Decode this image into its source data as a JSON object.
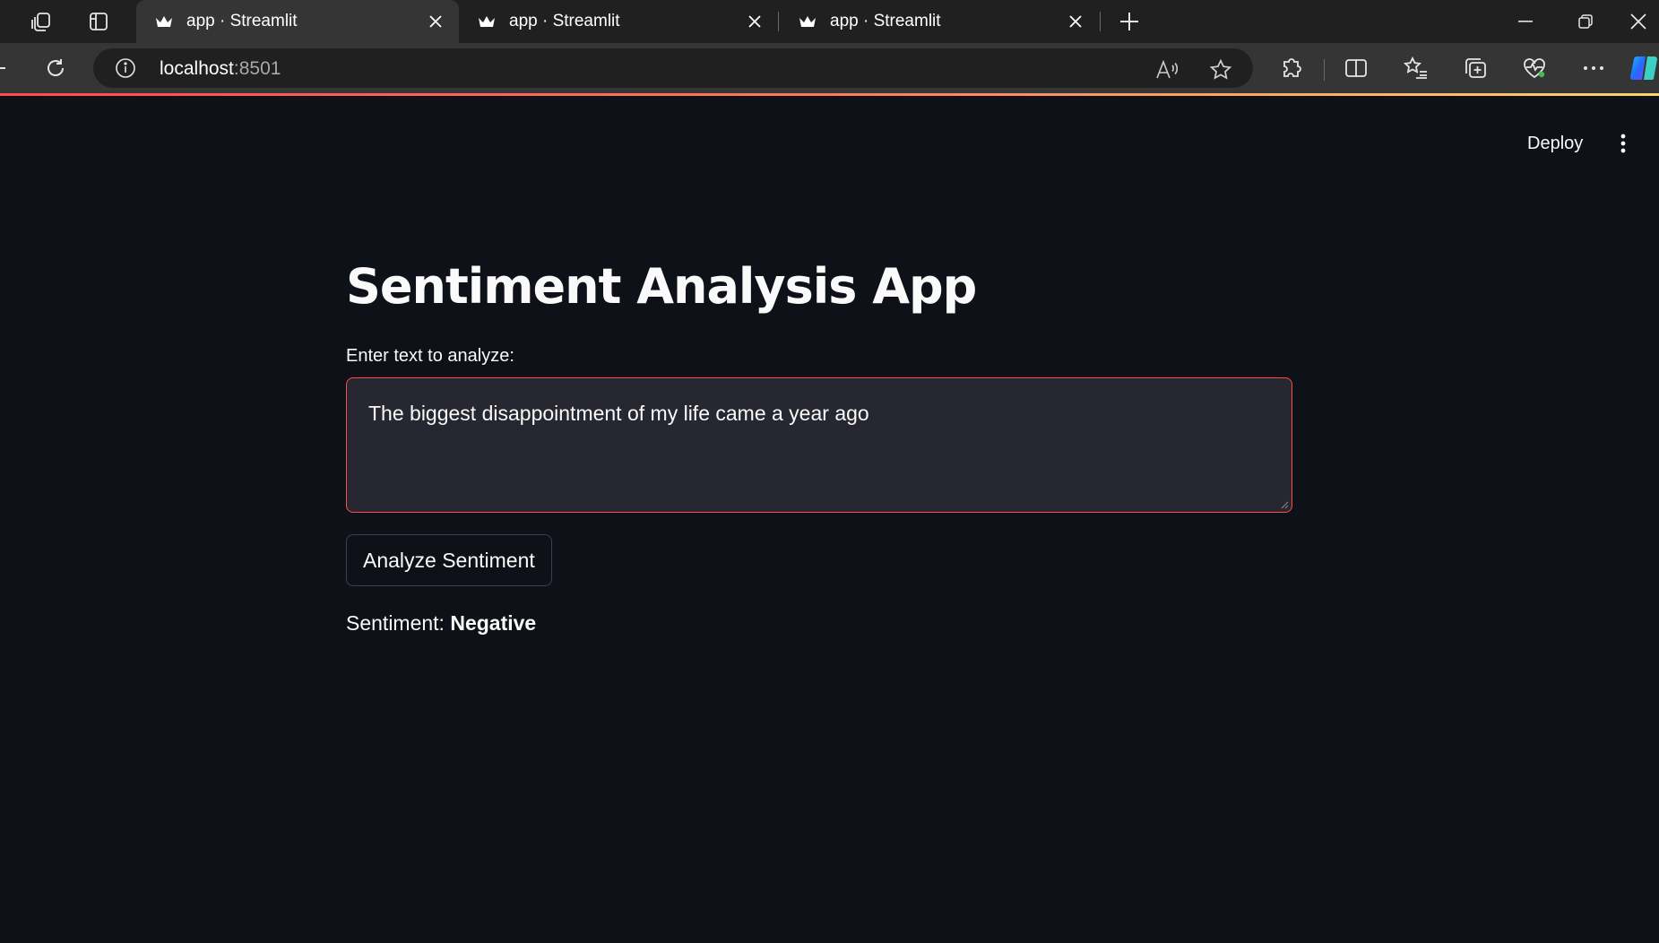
{
  "browser": {
    "tabs": [
      {
        "title": "app · Streamlit",
        "active": true
      },
      {
        "title": "app · Streamlit",
        "active": false
      },
      {
        "title": "app · Streamlit",
        "active": false
      }
    ],
    "address": {
      "host": "localhost",
      "port": ":8501"
    }
  },
  "icons": {
    "tab_actions": "tab-actions-icon",
    "vertical_tabs": "vertical-tabs-icon",
    "favicon": "streamlit-crown-icon",
    "close": "close-icon",
    "new_tab": "plus-icon",
    "back": "back-arrow-icon",
    "reload": "reload-icon",
    "site_info": "info-icon",
    "read_aloud": "read-aloud-icon",
    "favorite": "star-icon",
    "extensions": "puzzle-icon",
    "split_screen": "split-screen-icon",
    "favorites": "favorites-list-icon",
    "collections": "collections-icon",
    "health": "heart-pulse-icon",
    "more": "ellipsis-icon",
    "copilot": "copilot-icon",
    "kebab": "vertical-dots-icon"
  },
  "colors": {
    "app_bg": "#0e1117",
    "primary": "#ff4b4b",
    "input_bg": "#262730"
  },
  "app": {
    "deploy_label": "Deploy",
    "title": "Sentiment Analysis App",
    "input_label": "Enter text to analyze:",
    "input_value": "The biggest disappointment of my life came a year ago",
    "button_label": "Analyze Sentiment",
    "result_prefix": "Sentiment: ",
    "result_value": "Negative"
  }
}
